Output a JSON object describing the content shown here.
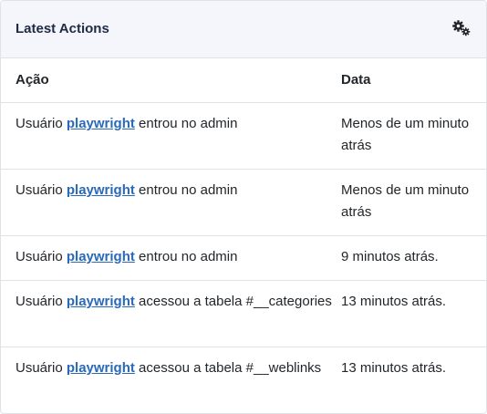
{
  "header": {
    "title": "Latest Actions",
    "options_icon": "gears-icon"
  },
  "table": {
    "columns": [
      "Ação",
      "Data"
    ],
    "rows": [
      {
        "prefix": "Usuário",
        "user": "playwright",
        "action": "entrou no admin",
        "date": "Menos de um minuto atrás"
      },
      {
        "prefix": "Usuário",
        "user": "playwright",
        "action": "entrou no admin",
        "date": "Menos de um minuto atrás"
      },
      {
        "prefix": "Usuário",
        "user": "playwright",
        "action": "entrou no admin",
        "date": "9 minutos atrás."
      },
      {
        "prefix": "Usuário",
        "user": "playwright",
        "action": "acessou a tabela #__categories",
        "date": "13 minutos atrás."
      },
      {
        "prefix": "Usuário",
        "user": "playwright",
        "action": "acessou a tabela #__weblinks",
        "date": "13 minutos atrás."
      }
    ]
  },
  "colors": {
    "header_bg": "#f4f6fc",
    "link": "#2a69b8",
    "border": "#dfe3e7"
  }
}
